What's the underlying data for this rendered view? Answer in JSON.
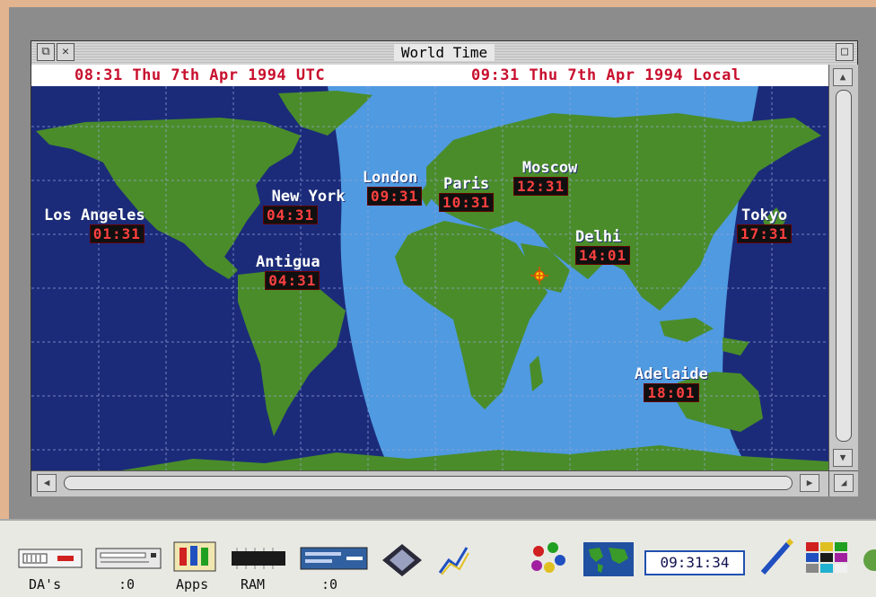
{
  "window": {
    "title": "World Time",
    "utc_line": "08:31 Thu 7th Apr 1994 UTC",
    "local_line": "09:31 Thu 7th Apr 1994 Local"
  },
  "cities": [
    {
      "name": "Los Angeles",
      "time": "01:31"
    },
    {
      "name": "New York",
      "time": "04:31"
    },
    {
      "name": "Antigua",
      "time": "04:31"
    },
    {
      "name": "London",
      "time": "09:31"
    },
    {
      "name": "Paris",
      "time": "10:31"
    },
    {
      "name": "Moscow",
      "time": "12:31"
    },
    {
      "name": "Delhi",
      "time": "14:01"
    },
    {
      "name": "Tokyo",
      "time": "17:31"
    },
    {
      "name": "Adelaide",
      "time": "18:01"
    }
  ],
  "iconbar": {
    "labels": {
      "das": "DA's",
      "drive1": ":0",
      "apps": "Apps",
      "ram": "RAM",
      "drive2": ":0"
    },
    "clock": "09:31:34"
  },
  "colors": {
    "ocean_night": "#1b2b7a",
    "ocean_day": "#4f9ae0",
    "land": "#4a8c2a",
    "time_text": "#ff4040",
    "header_text": "#c8102e"
  },
  "icons": [
    "floppy-drive-icon",
    "hard-drive-icon",
    "apps-folder-icon",
    "ram-chip-icon",
    "network-drive-icon",
    "diamond-icon",
    "draw-app-icon",
    "paint-app-icon",
    "world-map-icon",
    "pen-icon",
    "palette-icon"
  ]
}
